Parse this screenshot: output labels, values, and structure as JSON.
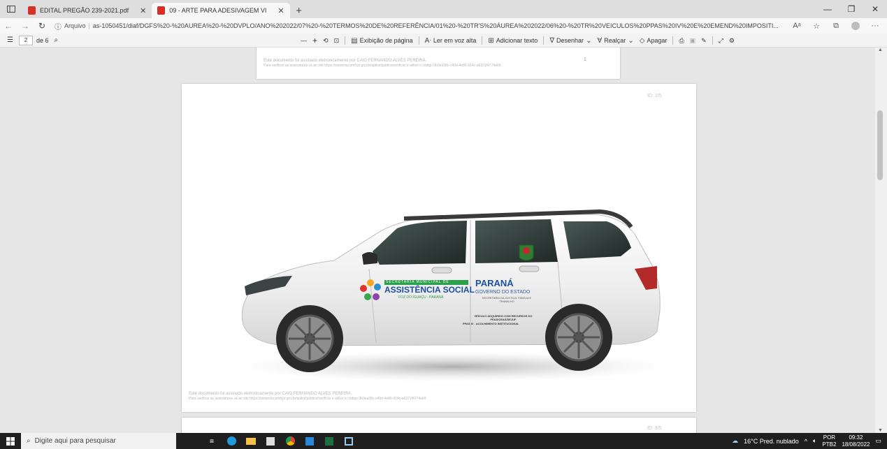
{
  "tabs": [
    {
      "title": "EDITAL PREGÃO 239-2021.pdf",
      "active": false
    },
    {
      "title": "09 - ARTE PARA ADESIVAGEM VI",
      "active": true
    }
  ],
  "address": {
    "security_label": "Arquivo",
    "url": "as-1050451/diaf/DGFS%20-%20AUREA%20-%20DVPLO/ANO%202022/07%20-%20TERMOS%20DE%20REFERÊNCIA/01%20-%20TR'S%20ÁUREA%202022/06%20-%20TR%20VEICULOS%20PPAS%20IV%20E%20EMEND%20IMPOSITI..."
  },
  "pdf_toolbar": {
    "page_current": "2",
    "page_total": "de 6",
    "zoom_out": "—",
    "zoom_in": "+",
    "page_view": "Exibição de página",
    "read_aloud": "Ler em voz alta",
    "add_text": "Adicionar texto",
    "draw": "Desenhar",
    "highlight": "Realçar",
    "erase": "Apagar"
  },
  "document": {
    "signature_line1": "Este documento foi assinado eletronicamente por CAIO FERNANDO ALVES PEREIRA.",
    "signature_line2": "Para verificar as assinaturas vá ao site https://sistemas.pmfi.pr.gov.br/spiksi/publico/verificar e utilize o código 0b3ea38c-c49d-4e86-914c-a6371f4774eb9",
    "page_number_top": "1",
    "page_id": "ID: 2/5",
    "page_id_next": "ID: 3/5",
    "vehicle_logo_left": {
      "line1": "SECRETARIA MUNICIPAL DE",
      "line2": "ASSISTÊNCIA SOCIAL",
      "line3": "FOZ DO IGUAÇU - PARANÁ"
    },
    "vehicle_logo_right": {
      "line1": "PARANÁ",
      "line2": "GOVERNO DO ESTADO",
      "line3": "SECRETARIA DA JUSTIÇA, FAMÍLIA E TRABALHO",
      "line4": "VEÍCULO ADQUIRIDO COM RECURSOS DO FEAS/CEAS/SEJUF",
      "line5": "PPAS IV - ACOLHIMENTO INSTITUCIONAL"
    }
  },
  "taskbar": {
    "search_placeholder": "Digite aqui para pesquisar",
    "weather": "16°C  Pred. nublado",
    "lang1": "POR",
    "lang2": "PTB2",
    "time": "09:32",
    "date": "18/08/2022"
  },
  "colors": {
    "accent_pdf": "#d93025",
    "taskbar": "#1f1f1f",
    "car": "#f2f2f2"
  }
}
